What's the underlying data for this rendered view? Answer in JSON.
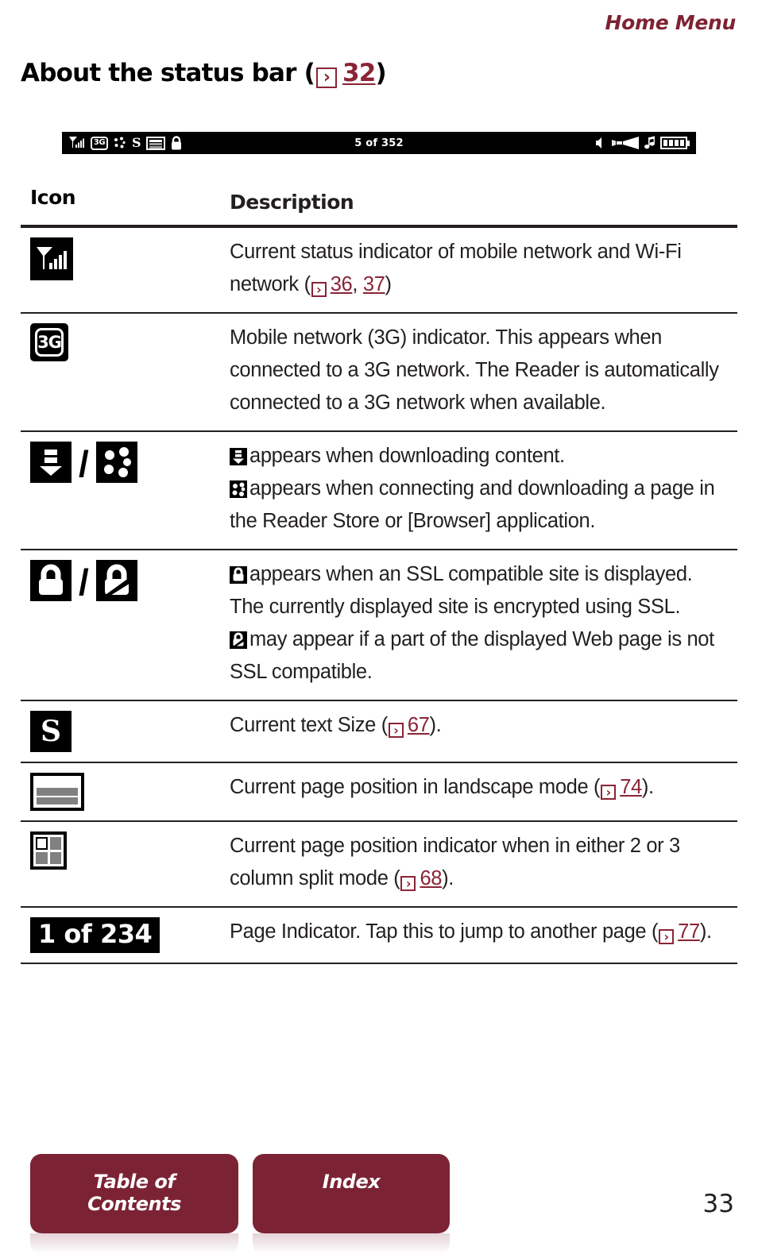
{
  "header": {
    "breadcrumb": "Home Menu"
  },
  "title": {
    "text": "About the status bar (",
    "jump_icon": "jump-arrow-icon",
    "page_ref": "32",
    "close_paren": ")"
  },
  "status_bar_graphic": {
    "left_icons": [
      "signal-icon",
      "3g-icon",
      "connecting-dots-icon",
      "text-size-s-icon",
      "page-position-landscape-icon",
      "lock-icon"
    ],
    "center_label": "5 of 352",
    "right_icons": [
      "volume-low-icon",
      "volume-high-icon",
      "music-note-icon",
      "battery-icon"
    ],
    "label_3g": "3G",
    "label_s": "S"
  },
  "table": {
    "headers": {
      "icon": "Icon",
      "description": "Description"
    },
    "rows": [
      {
        "icon_name": "signal-icon",
        "desc_parts": [
          {
            "type": "text",
            "value": "Current status indicator of mobile network and Wi-Fi network ("
          },
          {
            "type": "jump"
          },
          {
            "type": "link",
            "value": "36"
          },
          {
            "type": "text",
            "value": ", "
          },
          {
            "type": "link2",
            "value": "37"
          },
          {
            "type": "text",
            "value": ")"
          }
        ],
        "desc_plain": "Current status indicator of mobile network and Wi-Fi network (▷ 36, 37)"
      },
      {
        "icon_name": "3g-icon",
        "desc_plain": "Mobile network (3G) indicator. This appears when connected to a 3G network. The Reader is automatically connected to a 3G network when available."
      },
      {
        "icon_name": "download-icon / connecting-dots-icon",
        "desc_line1": "appears when downloading content.",
        "desc_line2": "appears when connecting and downloading a page in the Reader Store or [Browser] application."
      },
      {
        "icon_name": "lock-icon / broken-lock-icon",
        "desc_line1": "appears when an SSL compatible site is displayed. The currently displayed site is encrypted using SSL.",
        "desc_line2": "may appear if a part of the displayed Web page is not SSL compatible."
      },
      {
        "icon_name": "text-size-s-icon",
        "desc_pre": "Current text Size (",
        "desc_link": "67",
        "desc_post": ")."
      },
      {
        "icon_name": "page-position-landscape-icon",
        "desc_pre": "Current page position in landscape mode (",
        "desc_link": "74",
        "desc_post": ")."
      },
      {
        "icon_name": "column-split-icon",
        "desc_pre": "Current page position indicator when in either 2 or 3 column split mode (",
        "desc_link": "68",
        "desc_post": ")."
      },
      {
        "icon_name": "page-indicator-badge",
        "icon_label": "1 of 234",
        "desc_pre": "Page Indicator. Tap this to jump to another page (",
        "desc_link": "77",
        "desc_post": ")."
      }
    ]
  },
  "footer": {
    "toc_label": "Table of Contents",
    "index_label": "Index",
    "page_number": "33"
  },
  "colors": {
    "accent_red": "#7b2334",
    "link_red": "#8a2435",
    "ink": "#231f20"
  }
}
